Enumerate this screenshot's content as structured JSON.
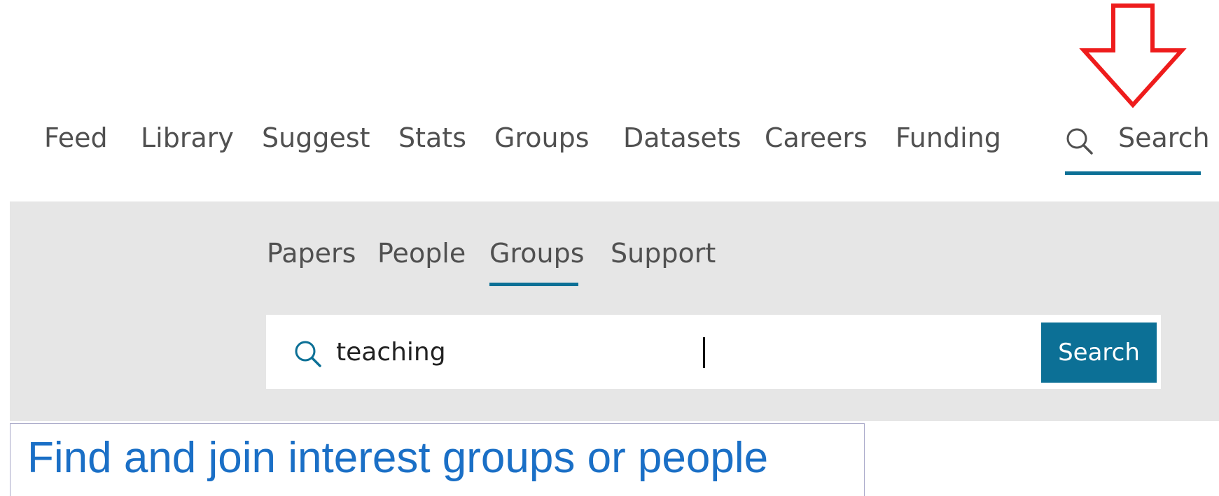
{
  "top_nav": {
    "items": [
      {
        "label": "Feed"
      },
      {
        "label": "Library"
      },
      {
        "label": "Suggest"
      },
      {
        "label": "Stats"
      },
      {
        "label": "Groups"
      },
      {
        "label": "Datasets"
      },
      {
        "label": "Careers"
      },
      {
        "label": "Funding"
      }
    ],
    "search_label": "Search",
    "active": "Search"
  },
  "search_panel": {
    "tabs": [
      {
        "label": "Papers"
      },
      {
        "label": "People"
      },
      {
        "label": "Groups"
      },
      {
        "label": "Support"
      }
    ],
    "active_tab": "Groups",
    "input_value": "teaching",
    "button_label": "Search"
  },
  "caption": {
    "text": "Find and join interest groups or people"
  },
  "annotation": {
    "icon": "arrow-down-icon",
    "color": "#ee1c1c"
  },
  "colors": {
    "accent": "#0c7096",
    "panel_bg": "#e6e6e6",
    "nav_text": "#505050",
    "caption_text": "#1a6fc6"
  }
}
